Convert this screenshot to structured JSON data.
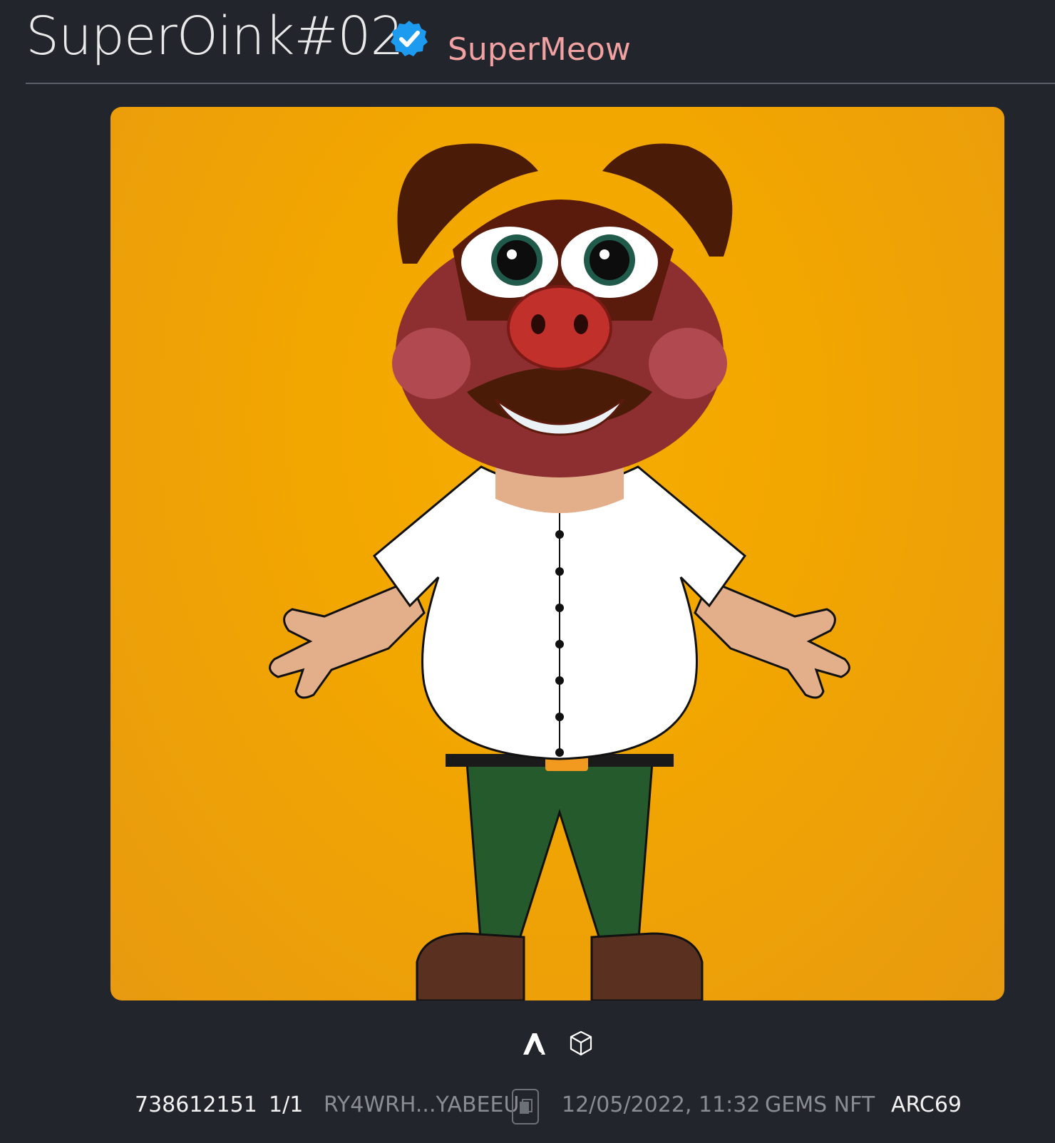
{
  "header": {
    "title": "SuperOink#02",
    "collection": "SuperMeow"
  },
  "image": {
    "background_color": "#f2a600"
  },
  "chain_icons": [
    "algorand-icon",
    "cube-icon"
  ],
  "meta": {
    "asset_id": "738612151",
    "edition": "1/1",
    "creator": "RY4WRH...YABEEU",
    "date": "12/05/2022, 11:32",
    "marketplace": "GEMS NFT",
    "standard": "ARC69"
  },
  "colors": {
    "background": "#22252b",
    "title": "#e9e9e9",
    "collection": "#f0a1a1",
    "verified": "#1d9bf0",
    "muted": "#8a8d93"
  }
}
